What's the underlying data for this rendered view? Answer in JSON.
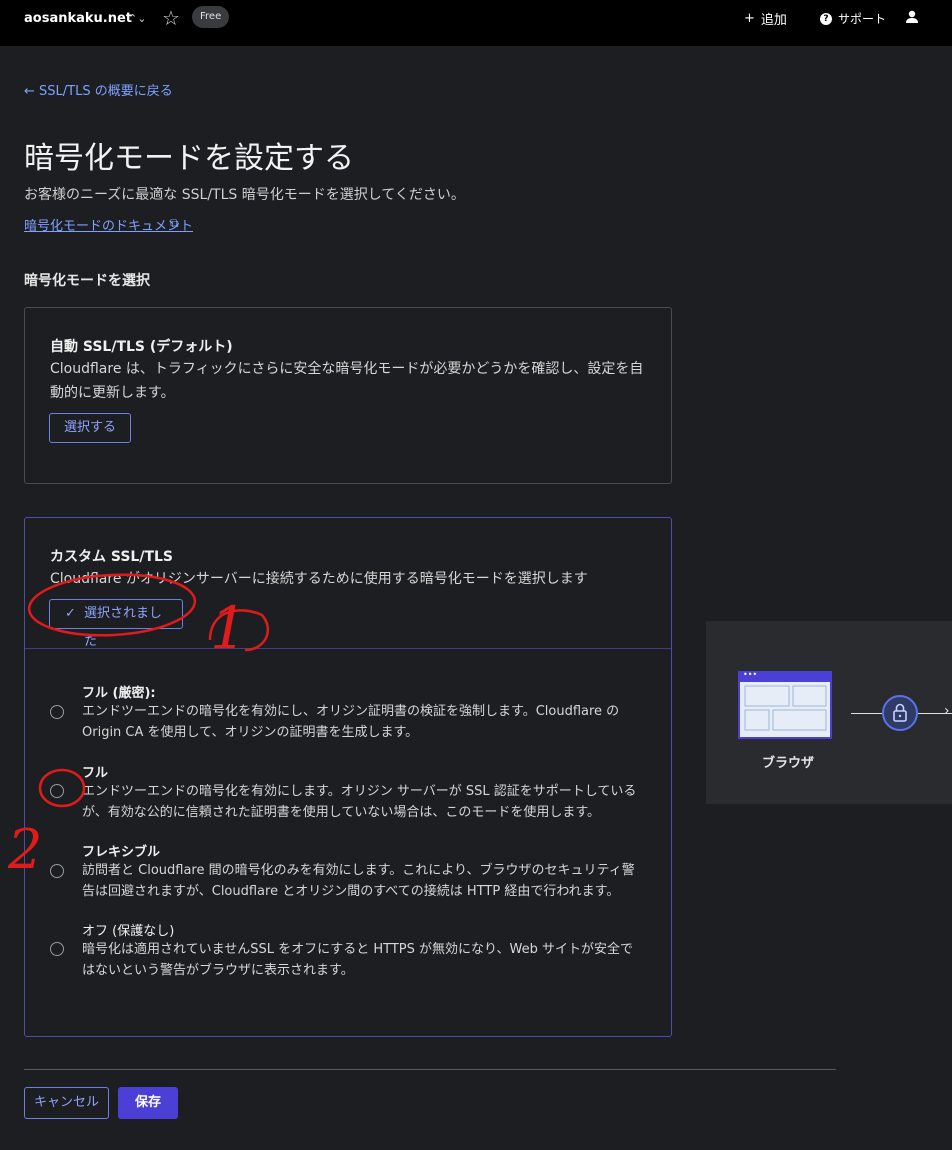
{
  "topbar": {
    "domain": "aosankaku.net",
    "plan_badge": "Free",
    "add_label": "追加",
    "support_label": "サポート"
  },
  "header": {
    "back_link": "← SSL/TLS の概要に戻る",
    "title": "暗号化モードを設定する",
    "description": "お客様のニーズに最適な SSL/TLS 暗号化モードを選択してください。",
    "doc_link": "暗号化モードのドキュメント"
  },
  "section_label": "暗号化モードを選択",
  "auto_card": {
    "title": "自動 SSL/TLS (デフォルト)",
    "description": "Cloudflare は、トラフィックにさらに安全な暗号化モードが必要かどうかを確認し、設定を自動的に更新します。",
    "button": "選択する"
  },
  "custom_card": {
    "title": "カスタム SSL/TLS",
    "description": "Cloudflare がオリジンサーバーに接続するために使用する暗号化モードを選択します",
    "button": "選択されました",
    "options": [
      {
        "title": "フル (厳密):",
        "description": "エンドツーエンドの暗号化を有効にし、オリジン証明書の検証を強制します。Cloudflare の Origin CA を使用して、オリジンの証明書を生成します。"
      },
      {
        "title": "フル",
        "description": "エンドツーエンドの暗号化を有効にします。オリジン サーバーが SSL 認証をサポートしているが、有効な公的に信頼された証明書を使用していない場合は、このモードを使用します。"
      },
      {
        "title": "フレキシブル",
        "description": "訪問者と Cloudflare 間の暗号化のみを有効にします。これにより、ブラウザのセキュリティ警告は回避されますが、Cloudflare とオリジン間のすべての接続は HTTP 経由で行われます。"
      },
      {
        "title": "オフ (保護なし)",
        "description": "暗号化は適用されていませんSSL をオフにすると HTTPS が無効になり、Web サイトが安全ではないという警告がブラウザに表示されます。"
      }
    ]
  },
  "diagram": {
    "browser_label": "ブラウザ"
  },
  "footer": {
    "cancel": "キャンセル",
    "save": "保存"
  },
  "annotations": {
    "mark_1": "1",
    "mark_2": "2"
  },
  "colors": {
    "accent": "#4b3fd6",
    "link": "#7ea1ff",
    "markup": "#e01b1b"
  }
}
